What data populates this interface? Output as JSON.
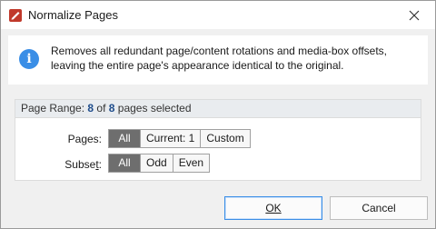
{
  "window": {
    "title": "Normalize Pages",
    "icon": "pdf-editor-icon",
    "close_icon": "close-icon"
  },
  "info": {
    "icon": "info-icon",
    "glyph": "i",
    "line1": "Removes all redundant page/content rotations and media-box offsets,",
    "line2": "leaving the entire page's appearance identical to the original."
  },
  "page_range": {
    "prefix": "Page Range: ",
    "selected": "8",
    "of_text": " of ",
    "total": "8",
    "suffix": " pages selected"
  },
  "pages": {
    "label": "Pages:",
    "options": [
      {
        "label": "All",
        "active": true
      },
      {
        "label": "Current: 1",
        "active": false
      },
      {
        "label": "Custom",
        "active": false
      }
    ]
  },
  "subset": {
    "label_pre": "Subse",
    "label_u": "t",
    "label_post": ":",
    "options": [
      {
        "label": "All",
        "active": true
      },
      {
        "label": "Odd",
        "active": false
      },
      {
        "label": "Even",
        "active": false
      }
    ]
  },
  "buttons": {
    "ok": "OK",
    "cancel": "Cancel"
  },
  "colors": {
    "accent": "#3a8ee6",
    "active_segment": "#6e6e6e",
    "app_icon": "#c0392b"
  }
}
